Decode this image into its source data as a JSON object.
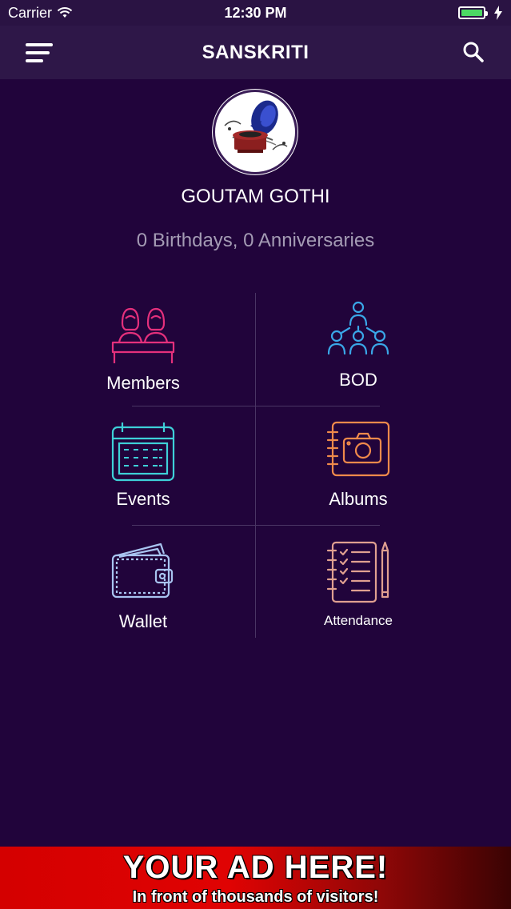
{
  "status_bar": {
    "carrier": "Carrier",
    "time": "12:30 PM"
  },
  "nav": {
    "title": "SANSKRITI",
    "menu_icon": "hamburger-menu-icon",
    "search_icon": "search-icon"
  },
  "profile": {
    "name": "GOUTAM GOTHI",
    "summary": "0 Birthdays, 0 Anniversaries",
    "avatar_icon": "gramophone-icon"
  },
  "grid": {
    "items": [
      {
        "label": "Members",
        "icon": "members-icon",
        "color": "#e5307c"
      },
      {
        "label": "BOD",
        "icon": "hierarchy-icon",
        "color": "#3aa7e8"
      },
      {
        "label": "Events",
        "icon": "calendar-icon",
        "color": "#3ed0d8"
      },
      {
        "label": "Albums",
        "icon": "camera-album-icon",
        "color": "#f08a4b"
      },
      {
        "label": "Wallet",
        "icon": "wallet-icon",
        "color": "#a8c4f0"
      },
      {
        "label": "Attendance",
        "icon": "checklist-icon",
        "color": "#e0a090"
      }
    ]
  },
  "ad": {
    "title": "YOUR AD HERE!",
    "subtitle": "In front of thousands of visitors!"
  },
  "colors": {
    "background": "#21043b",
    "nav_background": "#2e1748",
    "battery": "#4cd964"
  }
}
